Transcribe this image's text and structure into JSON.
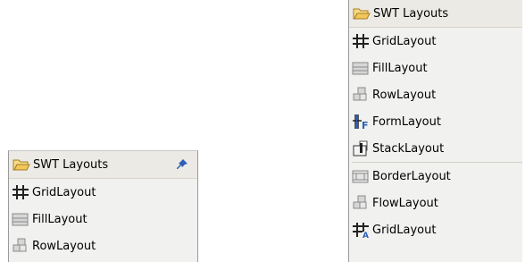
{
  "left_palette": {
    "title": "SWT Layouts",
    "items": [
      {
        "label": "GridLayout",
        "icon": "grid-layout-icon"
      },
      {
        "label": "FillLayout",
        "icon": "fill-layout-icon"
      },
      {
        "label": "RowLayout",
        "icon": "row-layout-icon"
      }
    ]
  },
  "right_palette": {
    "title": "SWT Layouts",
    "items": [
      {
        "label": "GridLayout",
        "icon": "grid-layout-icon"
      },
      {
        "label": "FillLayout",
        "icon": "fill-layout-icon"
      },
      {
        "label": "RowLayout",
        "icon": "row-layout-icon"
      },
      {
        "label": "FormLayout",
        "icon": "form-layout-icon"
      },
      {
        "label": "StackLayout",
        "icon": "stack-layout-icon"
      }
    ],
    "extra_items": [
      {
        "label": "BorderLayout",
        "icon": "border-layout-icon"
      },
      {
        "label": "FlowLayout",
        "icon": "flow-layout-icon"
      },
      {
        "label": "GridLayout",
        "icon": "grid-layout-alt-icon"
      }
    ]
  },
  "colors": {
    "panel_bg": "#f1f1ef",
    "folder_yellow": "#f2c75a",
    "pin_blue": "#2d5fb8"
  }
}
